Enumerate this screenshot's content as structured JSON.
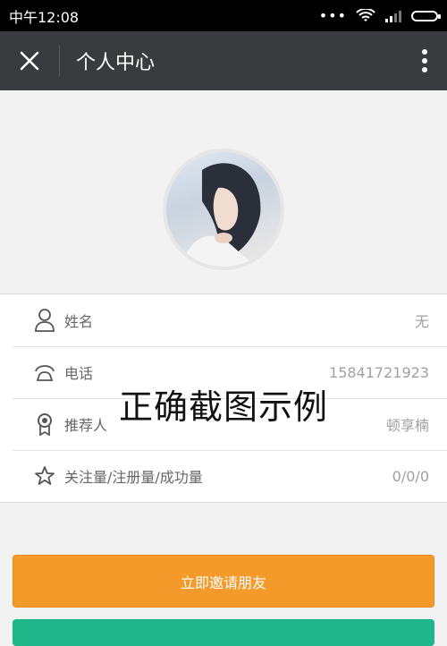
{
  "status": {
    "time": "中午12:08"
  },
  "appbar": {
    "title": "个人中心"
  },
  "info": [
    {
      "icon": "person-icon",
      "label": "姓名",
      "value": "无"
    },
    {
      "icon": "phone-icon",
      "label": "电话",
      "value": "15841721923"
    },
    {
      "icon": "badge-icon",
      "label": "推荐人",
      "value": "顿享楠"
    },
    {
      "icon": "star-icon",
      "label": "关注量/注册量/成功量",
      "value": "0/0/0"
    }
  ],
  "watermark": "正确截图示例",
  "buttons": {
    "invite": "立即邀请朋友"
  },
  "colors": {
    "appbar": "#3a3b3e",
    "invite": "#f49a2b",
    "second": "#1fb68a"
  }
}
